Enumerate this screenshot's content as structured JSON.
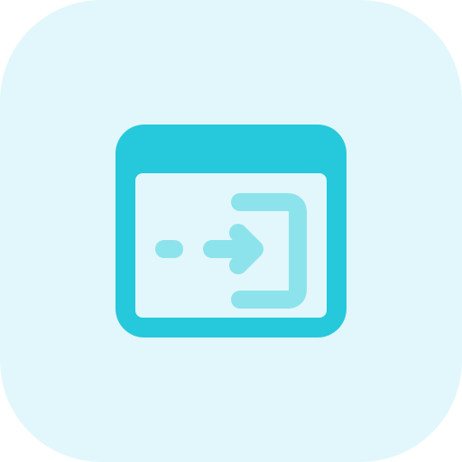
{
  "icon": {
    "name": "browser-login-icon",
    "colors": {
      "tile_background": "#E2F7FB",
      "window_primary": "#26C8DB",
      "window_inner": "#E2F7FB",
      "arrow_secondary": "#8DE3EB"
    }
  }
}
